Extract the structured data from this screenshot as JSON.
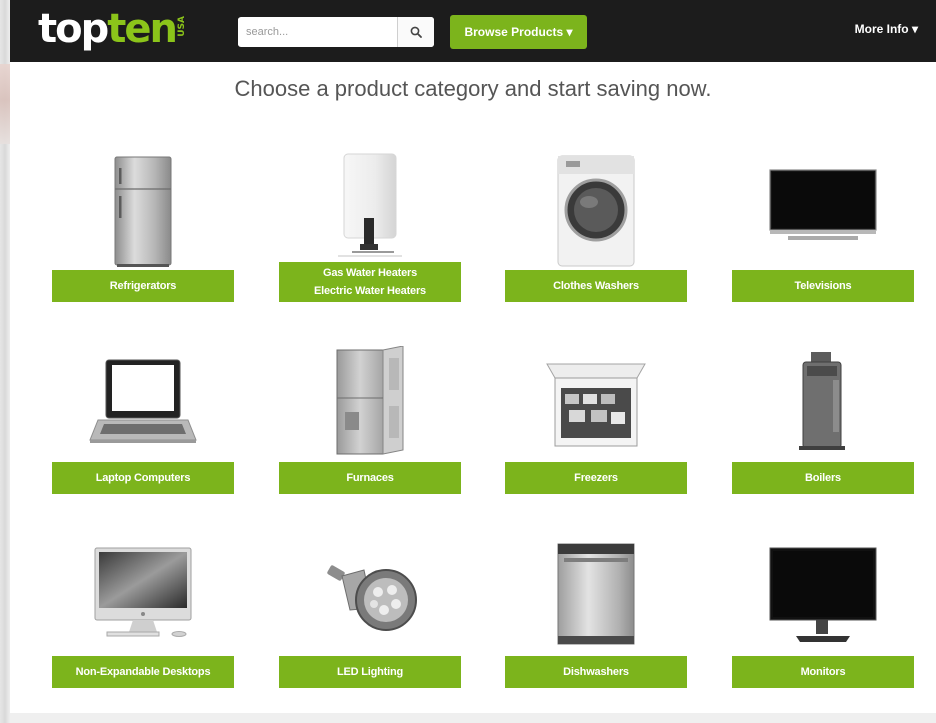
{
  "header": {
    "logo": {
      "top": "top",
      "ten": "ten",
      "usa": "USA"
    },
    "search": {
      "placeholder": "search..."
    },
    "browse_label": "Browse Products ▾",
    "more_info_label": "More Info ▾"
  },
  "headline": "Choose a product category and start saving now.",
  "categories": [
    {
      "label": "Refrigerators",
      "icon": "refrigerator-icon"
    },
    {
      "label": "Gas Water Heaters",
      "label2": "Electric Water Heaters",
      "icon": "water-heater-icon"
    },
    {
      "label": "Clothes Washers",
      "icon": "washer-icon"
    },
    {
      "label": "Televisions",
      "icon": "television-icon"
    },
    {
      "label": "Laptop Computers",
      "icon": "laptop-icon"
    },
    {
      "label": "Furnaces",
      "icon": "furnace-icon"
    },
    {
      "label": "Freezers",
      "icon": "freezer-icon"
    },
    {
      "label": "Boilers",
      "icon": "boiler-icon"
    },
    {
      "label": "Non-Expandable Desktops",
      "icon": "desktop-icon"
    },
    {
      "label": "LED Lighting",
      "icon": "led-bulb-icon"
    },
    {
      "label": "Dishwashers",
      "icon": "dishwasher-icon"
    },
    {
      "label": "Monitors",
      "icon": "monitor-icon"
    }
  ],
  "colors": {
    "brand_green": "#7cb41c",
    "header_bg": "#1c1c1c",
    "logo_green": "#8bc41a"
  }
}
